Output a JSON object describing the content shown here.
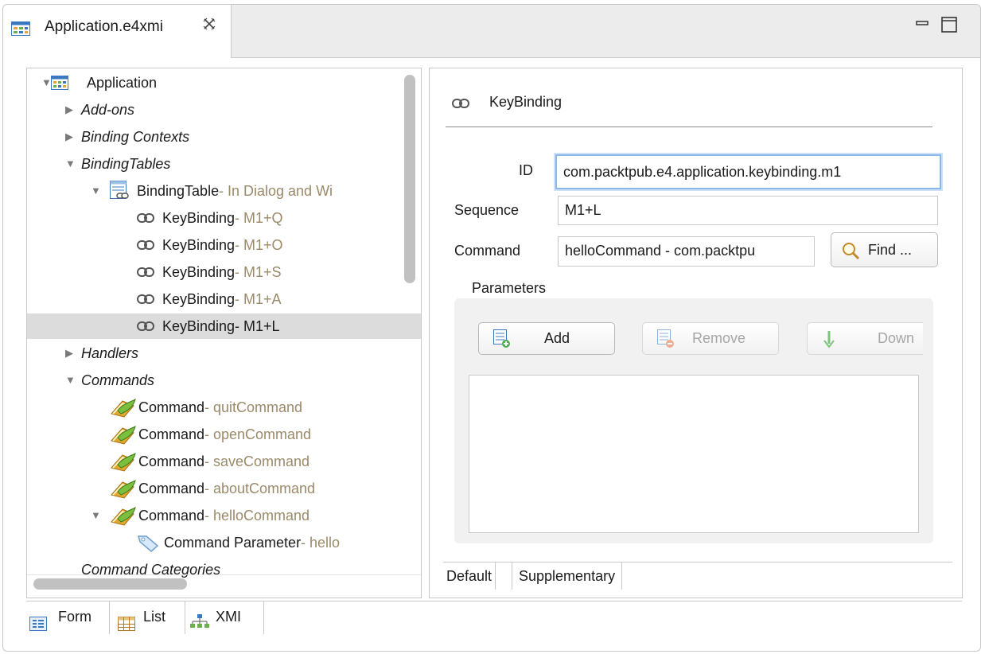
{
  "editor_tab": {
    "title": "Application.e4xmi",
    "close_icon": "close-icon"
  },
  "window_buttons": {
    "minimize": "minimize-icon",
    "maximize": "maximize-icon"
  },
  "tree": {
    "items": [
      {
        "label": "Application",
        "detail": "",
        "italic": false,
        "twisty": "open",
        "icon": "application-icon"
      },
      {
        "label": "Add-ons",
        "detail": "",
        "italic": true,
        "twisty": "closed",
        "icon": ""
      },
      {
        "label": "Binding Contexts",
        "detail": "",
        "italic": true,
        "twisty": "closed",
        "icon": ""
      },
      {
        "label": "BindingTables",
        "detail": "",
        "italic": true,
        "twisty": "open",
        "icon": ""
      },
      {
        "label": "BindingTable",
        "detail": " - In Dialog and Wi",
        "italic": false,
        "twisty": "open",
        "icon": "binding-table-icon"
      },
      {
        "label": "KeyBinding",
        "detail": " - M1+Q",
        "italic": false,
        "twisty": "",
        "icon": "link-icon"
      },
      {
        "label": "KeyBinding",
        "detail": " - M1+O",
        "italic": false,
        "twisty": "",
        "icon": "link-icon"
      },
      {
        "label": "KeyBinding",
        "detail": " - M1+S",
        "italic": false,
        "twisty": "",
        "icon": "link-icon"
      },
      {
        "label": "KeyBinding",
        "detail": " - M1+A",
        "italic": false,
        "twisty": "",
        "icon": "link-icon"
      },
      {
        "label": "KeyBinding",
        "detail": " - M1+L",
        "italic": false,
        "twisty": "",
        "icon": "link-icon"
      },
      {
        "label": "Handlers",
        "detail": "",
        "italic": true,
        "twisty": "closed",
        "icon": ""
      },
      {
        "label": "Commands",
        "detail": "",
        "italic": true,
        "twisty": "open",
        "icon": ""
      },
      {
        "label": "Command",
        "detail": " - quitCommand",
        "italic": false,
        "twisty": "",
        "icon": "command-icon"
      },
      {
        "label": "Command",
        "detail": " - openCommand",
        "italic": false,
        "twisty": "",
        "icon": "command-icon"
      },
      {
        "label": "Command",
        "detail": " - saveCommand",
        "italic": false,
        "twisty": "",
        "icon": "command-icon"
      },
      {
        "label": "Command",
        "detail": " - aboutCommand",
        "italic": false,
        "twisty": "",
        "icon": "command-icon"
      },
      {
        "label": "Command",
        "detail": " - helloCommand",
        "italic": false,
        "twisty": "open",
        "icon": "command-icon"
      },
      {
        "label": "Command Parameter",
        "detail": " - hello",
        "italic": false,
        "twisty": "",
        "icon": "tag-icon"
      },
      {
        "label": "Command Categories",
        "detail": "",
        "italic": true,
        "twisty": "",
        "icon": ""
      }
    ],
    "selected_index": 9
  },
  "bottom_tabs": [
    {
      "label": "Form",
      "icon": "form-icon"
    },
    {
      "label": "List",
      "icon": "table-icon"
    },
    {
      "label": "XMI",
      "icon": "hierarchy-icon"
    }
  ],
  "form": {
    "title": "KeyBinding",
    "id_label": "ID",
    "id_value": "com.packtpub.e4.application.keybinding.m1",
    "sequence_label": "Sequence",
    "sequence_value": "M1+L",
    "command_label": "Command",
    "command_value": "helloCommand - com.packtpu",
    "find_label": "Find ...",
    "parameters_label": "Parameters",
    "add_label": "Add",
    "remove_label": "Remove",
    "down_label": "Down",
    "tabs": [
      "Default",
      "Supplementary"
    ]
  }
}
